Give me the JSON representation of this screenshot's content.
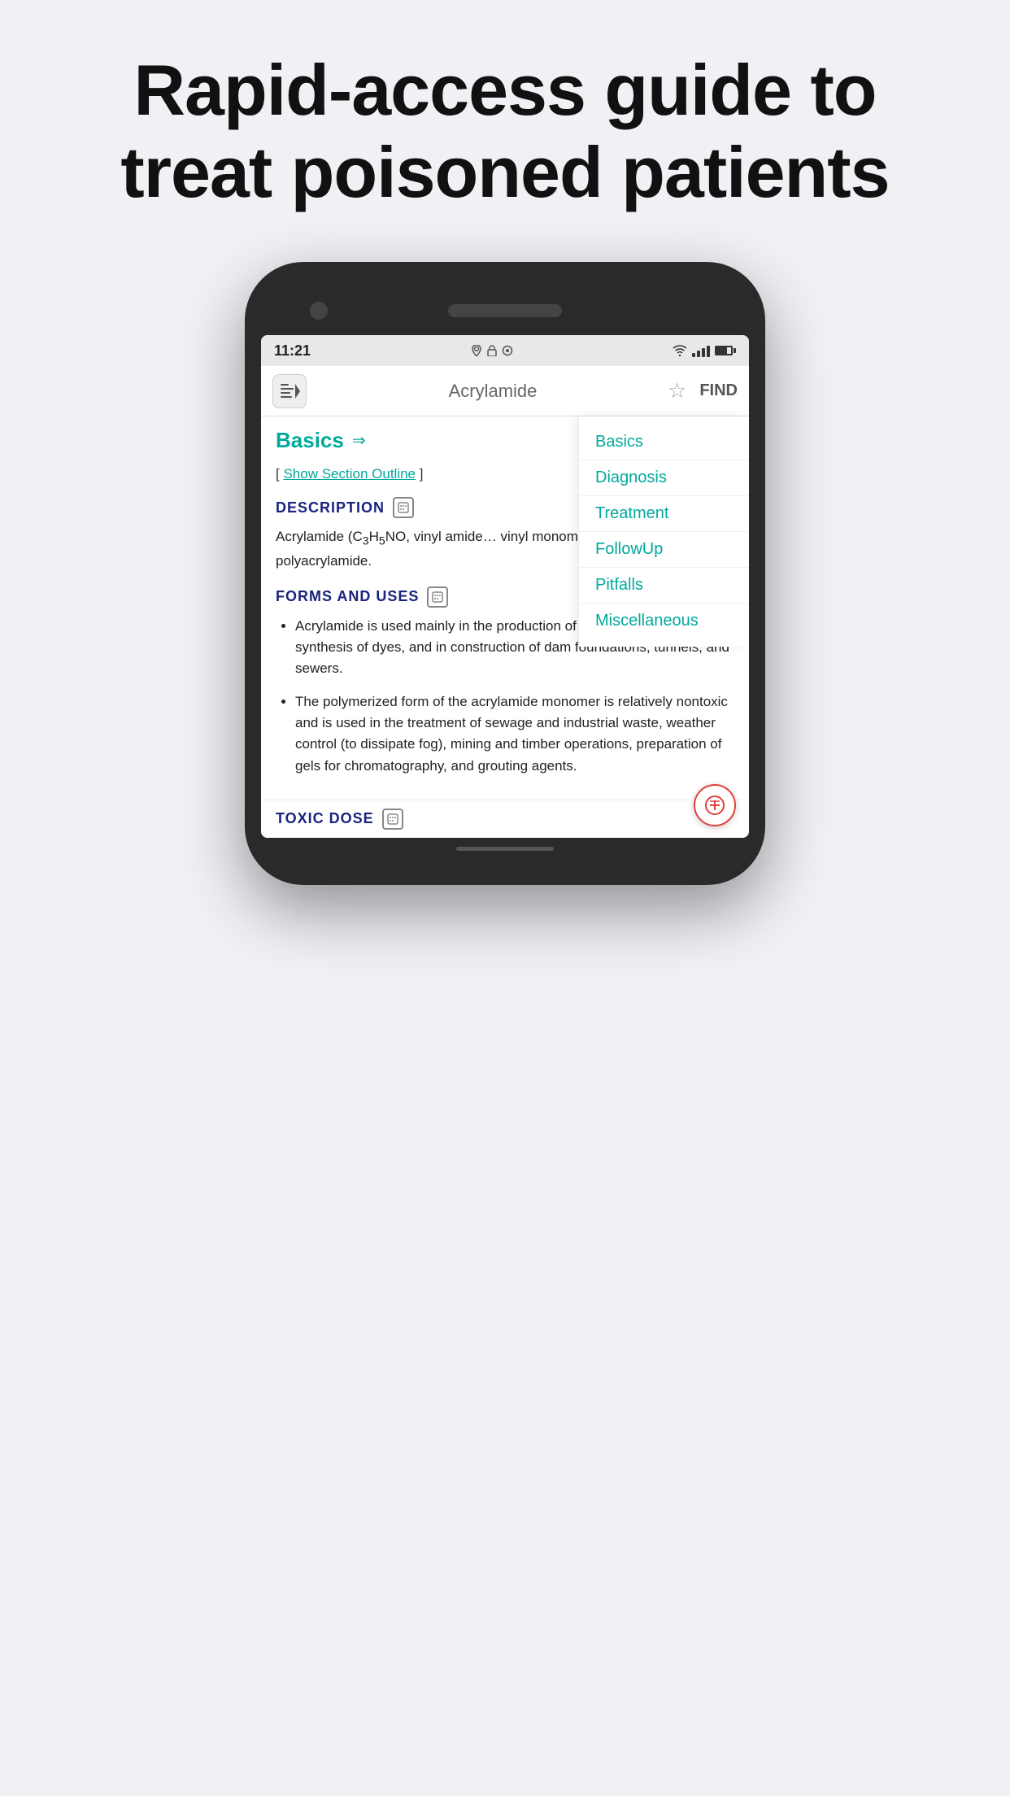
{
  "hero": {
    "title": "Rapid-access guide to treat poisoned patients"
  },
  "phone": {
    "status_bar": {
      "time": "11:21",
      "icons_left": [
        "location",
        "lock",
        "sync"
      ],
      "icons_right": [
        "wifi",
        "signal",
        "battery"
      ]
    },
    "app_header": {
      "logo_icon": "menu-icon",
      "title": "Acrylamide",
      "star_label": "☆",
      "find_label": "FIND"
    },
    "section_nav": {
      "items": [
        "Basics",
        "Diagnosis",
        "Treatment",
        "FollowUp",
        "Pitfalls",
        "Miscellaneous"
      ]
    },
    "content": {
      "basics_label": "Basics",
      "show_outline_prefix": "[",
      "show_outline_link": "Show Section Outline",
      "show_outline_suffix": "]",
      "description_heading": "DESCRIPTION",
      "description_text": "Acrylamide (C₃H₅NO, vinyl amide… vinyl monomer that is used to make polyacrylamide.",
      "forms_uses_heading": "FORMS AND USES",
      "bullet_1": "Acrylamide is used mainly in the production of polyacrylamide, in the synthesis of dyes, and in construction of dam foundations, tunnels, and sewers.",
      "bullet_2": "The polymerized form of the acrylamide monomer is relatively nontoxic and is used in the treatment of sewage and industrial waste, weather control (to dissipate fog), mining and timber operations, preparation of gels for chromatography, and grouting agents.",
      "toxic_dose_heading": "TOXIC DOSE"
    }
  },
  "colors": {
    "teal": "#00a99d",
    "dark_blue": "#1a237e",
    "red": "#e0423a",
    "background": "#f0f0f5",
    "text_dark": "#222222",
    "text_gray": "#666666"
  }
}
